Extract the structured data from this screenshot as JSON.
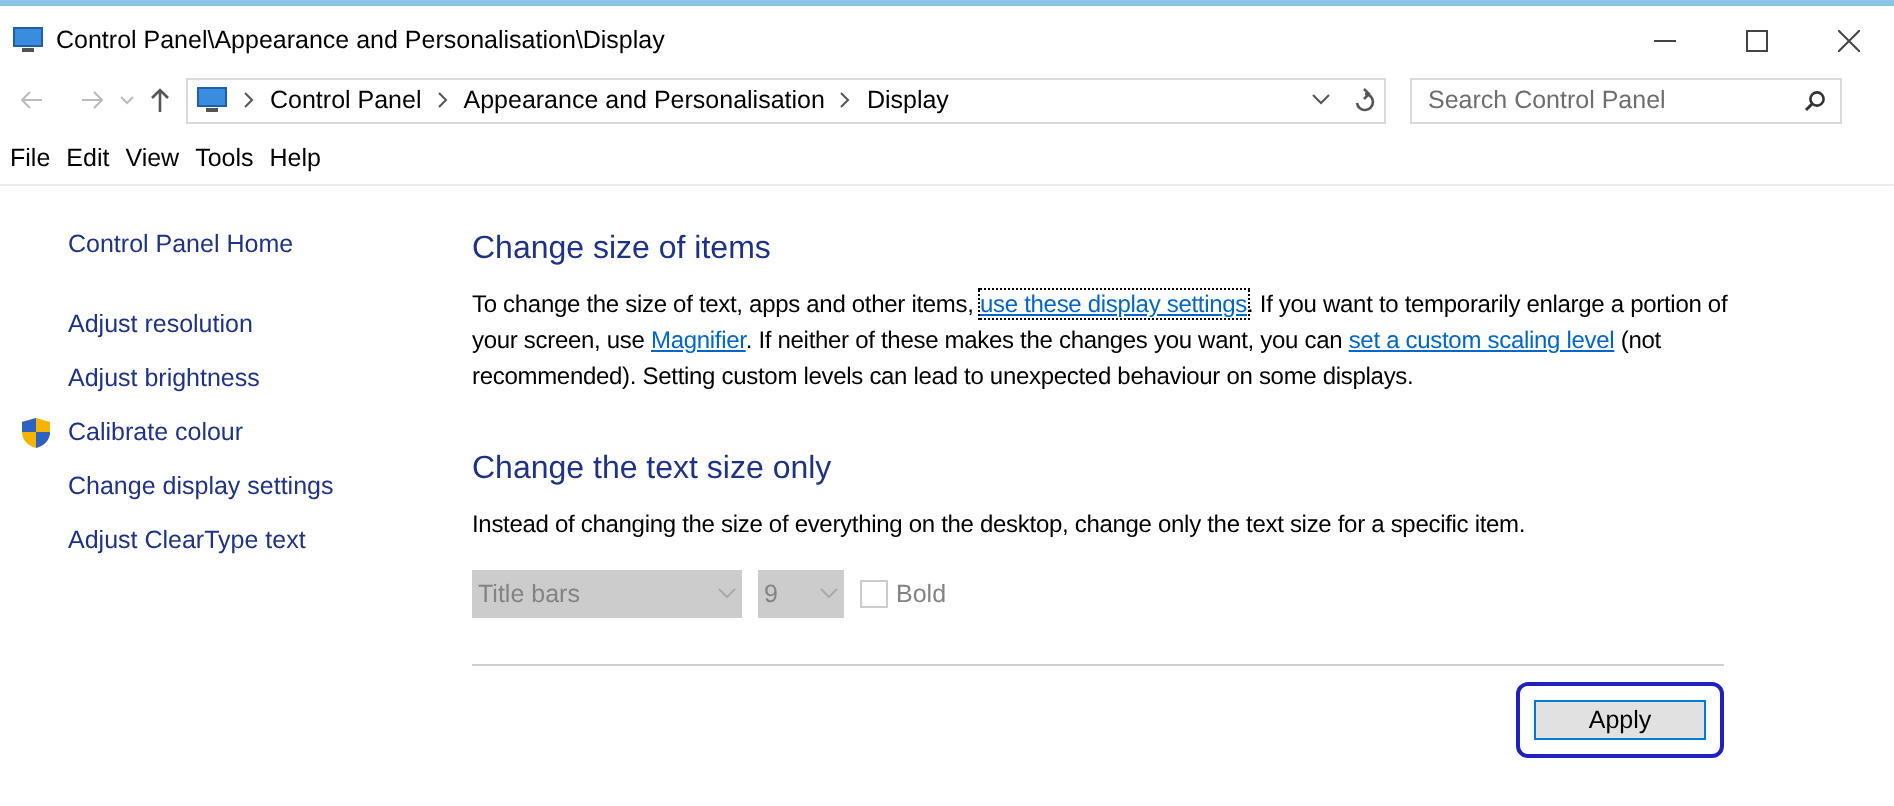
{
  "window": {
    "title": "Control Panel\\Appearance and Personalisation\\Display"
  },
  "address_bar": {
    "crumbs": [
      "Control Panel",
      "Appearance and Personalisation",
      "Display"
    ]
  },
  "search": {
    "placeholder": "Search Control Panel"
  },
  "menu": [
    "File",
    "Edit",
    "View",
    "Tools",
    "Help"
  ],
  "sidebar": {
    "items": [
      {
        "label": "Control Panel Home",
        "kind": "home"
      },
      {
        "label": "Adjust resolution",
        "kind": "link"
      },
      {
        "label": "Adjust brightness",
        "kind": "link"
      },
      {
        "label": "Calibrate colour",
        "kind": "shield"
      },
      {
        "label": "Change display settings",
        "kind": "link"
      },
      {
        "label": "Adjust ClearType text",
        "kind": "link"
      }
    ]
  },
  "sections": [
    {
      "heading": "Change size of items",
      "parts": [
        {
          "kind": "text",
          "text": "To change the size of text, apps and other items, "
        },
        {
          "kind": "link",
          "text": "use these display settings",
          "focused": true
        },
        {
          "kind": "text",
          "text": ". If you want to temporarily enlarge a portion of your screen, use "
        },
        {
          "kind": "link",
          "text": "Magnifier",
          "focused": false
        },
        {
          "kind": "text",
          "text": ". If neither of these makes the changes you want, you can "
        },
        {
          "kind": "link",
          "text": "set a custom scaling level",
          "focused": false
        },
        {
          "kind": "text",
          "text": " (not recommended). Setting custom levels can lead to unexpected behaviour on some displays."
        }
      ]
    },
    {
      "heading": "Change the text size only",
      "parts": [
        {
          "kind": "text",
          "text": "Instead of changing the size of everything on the desktop, change only the text size for a specific item."
        }
      ]
    }
  ],
  "text_size": {
    "item": {
      "value": "Title bars",
      "disabled": true
    },
    "size": {
      "value": "9",
      "disabled": true
    },
    "bold": {
      "label": "Bold",
      "checked": false,
      "disabled": true
    }
  },
  "apply_button": {
    "label": "Apply",
    "focused": true
  }
}
